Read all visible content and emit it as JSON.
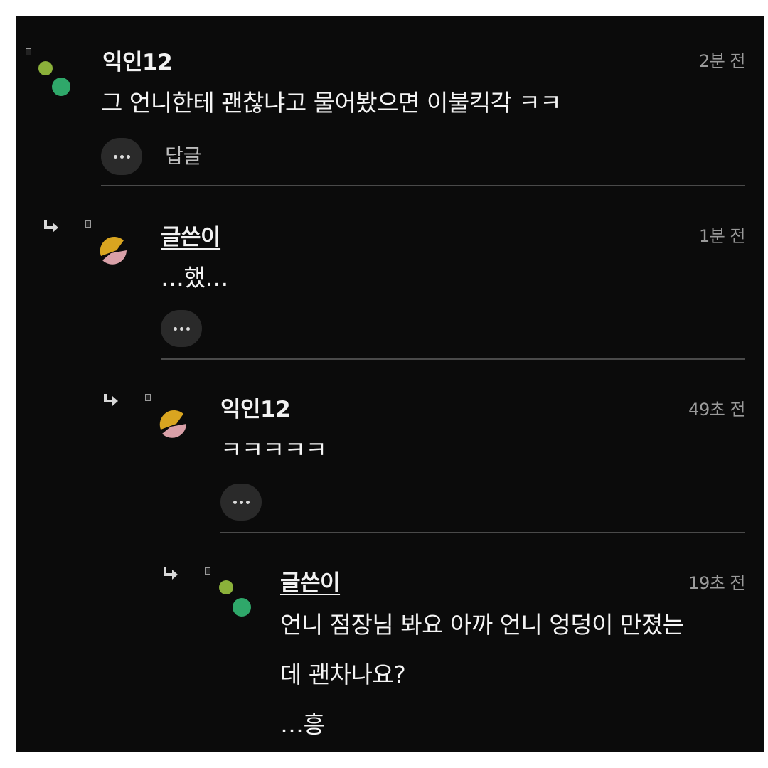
{
  "comments": [
    {
      "name": "익인12",
      "time": "2분 전",
      "text": "그 언니한테 괜찮냐고 물어봤으면 이불킥각 ㅋㅋ",
      "reply_label": "답글"
    },
    {
      "name": "글쓴이",
      "time": "1분 전",
      "text": "…했…"
    },
    {
      "name": "익인12",
      "time": "49초 전",
      "text": "ㅋㅋㅋㅋㅋ"
    },
    {
      "name": "글쓴이",
      "time": "19초 전",
      "text_line1": "언니 점장님 봐요 아까 언니 엉덩이 만졌는",
      "text_line2": "데 괜차나요?",
      "text_line3": "…흥"
    }
  ],
  "icons": {
    "more": "more-options-icon",
    "reply": "reply-arrow-icon",
    "avatar_dots": "avatar-dots-icon",
    "avatar_pie": "avatar-pie-icon",
    "badge": "badge-icon"
  },
  "colors": {
    "background": "#0b0b0b",
    "text": "#f4f4f4",
    "muted": "#9a9a9a",
    "avatar_green_light": "#8bb13a",
    "avatar_green": "#2fa86a",
    "avatar_gold": "#d9a520",
    "avatar_pink": "#d9a0a8"
  }
}
